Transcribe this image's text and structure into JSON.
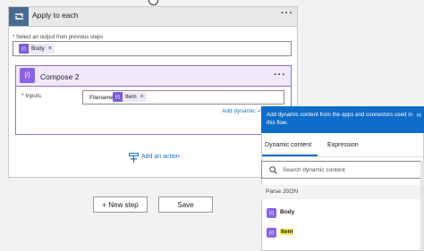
{
  "apply_to_each": {
    "title": "Apply to each",
    "select_label": "* Select an output from previous steps",
    "select_token": "Body"
  },
  "compose": {
    "title": "Compose 2",
    "inputs_label": "* Inputs",
    "inputs_text": "Filename:",
    "inputs_token": "Item",
    "add_dynamic": "Add dynamic ✓"
  },
  "add_action": "Add an action",
  "buttons": {
    "new_step": "+ New step",
    "save": "Save"
  },
  "dynamic_panel": {
    "banner": "Add dynamic content from the apps and connectors used in this flow.",
    "banner_overflow": "H",
    "tabs": [
      "Dynamic content",
      "Expression"
    ],
    "search_placeholder": "Search dynamic content",
    "section": "Parse JSON",
    "items": [
      "Body",
      "Item"
    ]
  },
  "colors": {
    "compose_accent": "#8a63e6",
    "link": "#1f6fc5",
    "banner": "#0f6cc9",
    "highlight": "#f6e94a"
  }
}
